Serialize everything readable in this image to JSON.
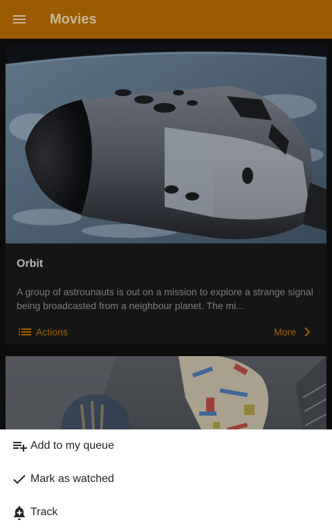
{
  "appbar": {
    "title": "Movies",
    "menu_icon": "menu-icon",
    "color": "#9a5b00"
  },
  "cards": [
    {
      "title": "Orbit",
      "description": "A group of astrounauts is out on a mission to explore a strange signal being broadcasted from a neighbour planet. The mi...",
      "actions_label": "Actions",
      "more_label": "More",
      "image": "space-shuttle-over-earth"
    },
    {
      "image": "painted-face-sculpture"
    }
  ],
  "bottom_sheet": {
    "items": [
      {
        "label": "Add to my queue",
        "icon": "playlist-add-icon"
      },
      {
        "label": "Mark as watched",
        "icon": "check-icon"
      },
      {
        "label": "Track",
        "icon": "bell-add-icon"
      }
    ]
  },
  "accent_color": "#a36400"
}
